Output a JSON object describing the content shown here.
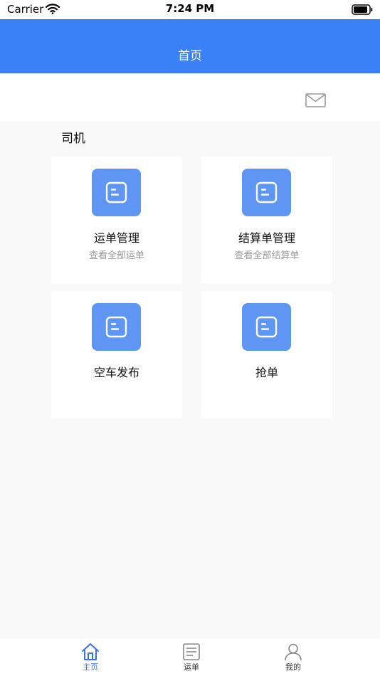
{
  "status_bar": {
    "carrier": "Carrier",
    "time": "7:24 PM",
    "wifi_icon": "wifi-icon",
    "battery_icon": "battery-icon"
  },
  "header": {
    "title": "首页",
    "background_color": "#3a80f6"
  },
  "message_bar": {
    "icon": "mail-icon"
  },
  "section": {
    "title": "司机"
  },
  "cards": [
    {
      "title": "运单管理",
      "subtitle": "查看全部运单",
      "icon": "document-icon"
    },
    {
      "title": "结算单管理",
      "subtitle": "查看全部结算单",
      "icon": "document-icon"
    },
    {
      "title": "空车发布",
      "subtitle": "",
      "icon": "document-icon"
    },
    {
      "title": "抢单",
      "subtitle": "",
      "icon": "document-icon"
    }
  ],
  "tile_color": "#5f96f3",
  "tabbar": {
    "active_color": "#3a72e8",
    "items": [
      {
        "label": "主页",
        "icon": "home-icon",
        "active": true
      },
      {
        "label": "运单",
        "icon": "list-icon",
        "active": false
      },
      {
        "label": "我的",
        "icon": "user-icon",
        "active": false
      }
    ]
  }
}
